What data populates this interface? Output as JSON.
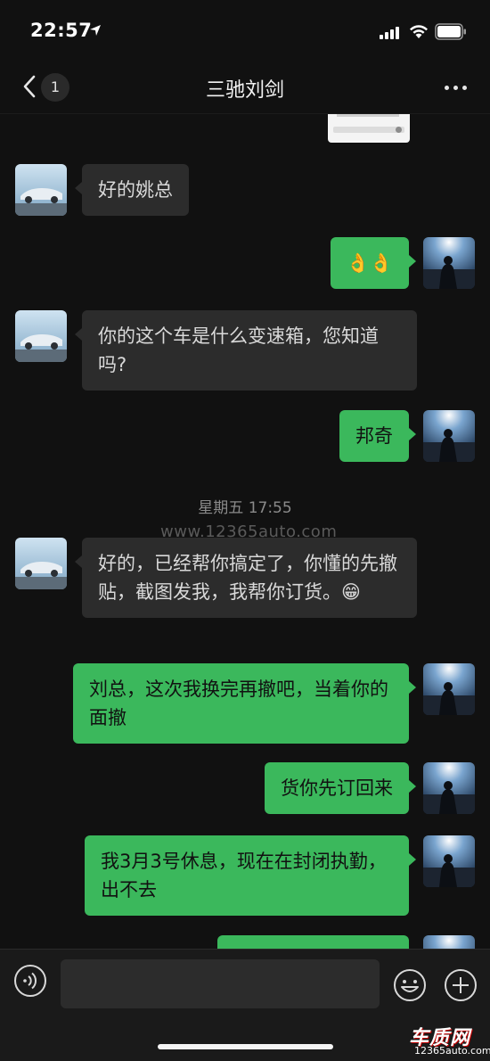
{
  "status_bar": {
    "time": "22:57"
  },
  "nav": {
    "unread_count": "1",
    "title": "三驰刘剑"
  },
  "messages": [
    {
      "side": "left",
      "text": "好的姚总"
    },
    {
      "side": "right",
      "text": "👌👌"
    },
    {
      "side": "left",
      "text": "你的这个车是什么变速箱，您知道吗?"
    },
    {
      "side": "right",
      "text": "邦奇"
    },
    {
      "side": "left",
      "text": "好的，已经帮你搞定了，你懂的先撤贴，截图发我，我帮你订货。😁"
    },
    {
      "side": "right",
      "text": "刘总，这次我换完再撤吧，当着你的面撤"
    },
    {
      "side": "right",
      "text": "货你先订回来"
    },
    {
      "side": "right",
      "text": "我3月3号休息，现在在封闭执勤，出不去"
    }
  ],
  "time_divider": "星期五 17:55",
  "watermark": "www.12365auto.com",
  "input": {
    "placeholder": ""
  },
  "site_logo": {
    "main": "车质网",
    "sub": "12365auto.com"
  },
  "colors": {
    "background": "#111111",
    "bubble_in": "#2c2c2c",
    "bubble_out": "#3bb85c"
  }
}
